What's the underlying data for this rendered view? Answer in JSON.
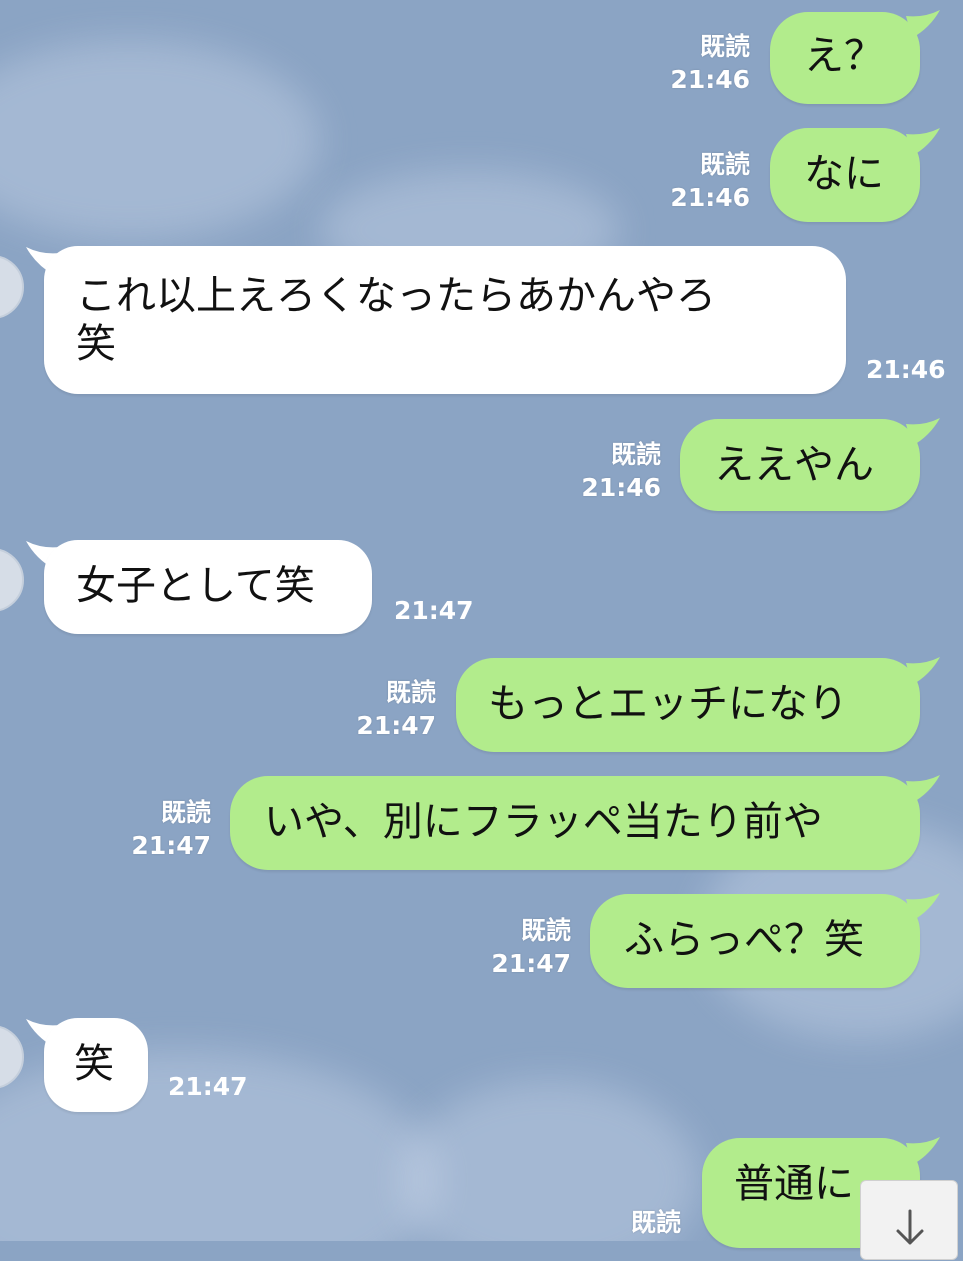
{
  "messages": [
    {
      "dir": "out",
      "text": "え？",
      "read": "既読",
      "time": "21:46"
    },
    {
      "dir": "out",
      "text": "なに",
      "read": "既読",
      "time": "21:46"
    },
    {
      "dir": "in",
      "line1": "これ以上えろくなったらあかんやろ",
      "line2": "笑",
      "time": "21:46"
    },
    {
      "dir": "out",
      "text": "ええやん",
      "read": "既読",
      "time": "21:46"
    },
    {
      "dir": "in",
      "text": "女子として笑",
      "time": "21:47"
    },
    {
      "dir": "out",
      "text": "もっとエッチになり",
      "read": "既読",
      "time": "21:47"
    },
    {
      "dir": "out",
      "text": "いや、別にフラッペ当たり前や",
      "read": "既読",
      "time": "21:47"
    },
    {
      "dir": "out",
      "text": "ふらっぺ？笑",
      "read": "既読",
      "time": "21:47"
    },
    {
      "dir": "in",
      "text": "笑",
      "time": "21:47"
    },
    {
      "dir": "out",
      "text": "普通に",
      "read": "既読"
    }
  ],
  "colors": {
    "background": "#8ba4c4",
    "outgoing_bubble": "#b2ec8c",
    "incoming_bubble": "#ffffff",
    "meta_text": "#ffffff"
  },
  "icons": {
    "scroll_down": "arrow-down-icon"
  }
}
